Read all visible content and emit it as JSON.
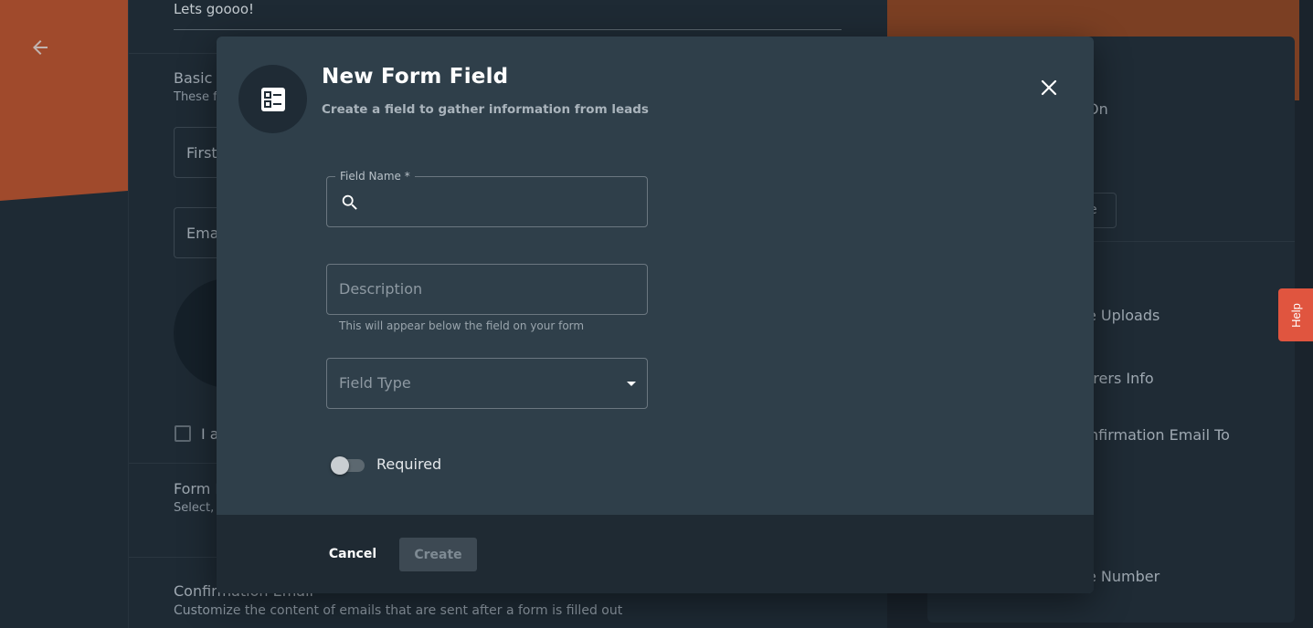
{
  "background": {
    "intro_text": "Lets goooo!",
    "basic_section_title": "Basic",
    "basic_section_desc": "These f",
    "first_field_placeholder": "First",
    "email_field_placeholder": "Ema",
    "checkbox_label": "I a",
    "form_section_title": "Form I",
    "form_section_desc": "Select,",
    "confirmation_title": "Confirmation Email",
    "confirmation_desc": "Customize the content of emails that are sent after a form is filled out",
    "right_panel": {
      "item_on": "On",
      "button_fragment": "e",
      "item_uploads": "e Uploads",
      "item_referrers": "rrers Info",
      "item_confirmation": "nfirmation Email To",
      "item_phone": "e Number"
    },
    "help_label": "Help"
  },
  "modal": {
    "title": "New Form Field",
    "subtitle": "Create a field to gather information from leads",
    "field_name_label": "Field Name *",
    "field_name_value": "",
    "description_placeholder": "Description",
    "description_helper": "This will appear below the field on your form",
    "field_type_placeholder": "Field Type",
    "required_label": "Required",
    "required_on": false,
    "cancel_label": "Cancel",
    "create_label": "Create",
    "icons": {
      "header": "form-list-icon",
      "close": "close-icon",
      "search": "search-icon",
      "dropdown": "caret-down-icon"
    }
  },
  "colors": {
    "modal_bg": "#2f3f4a",
    "footer_bg": "#1f2a33",
    "help_tab": "#e0553f",
    "accent_orange": "#a04a2c"
  }
}
